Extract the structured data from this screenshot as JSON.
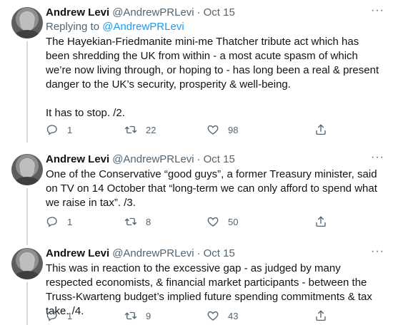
{
  "tweets": [
    {
      "name": "Andrew Levi",
      "handle": "@AndrewPRLevi",
      "separator": "·",
      "date": "Oct 15",
      "more": "···",
      "replying_prefix": "Replying to ",
      "replying_to": "@AndrewPRLevi",
      "text": "The Hayekian-Friedmanite mini-me Thatcher tribute act which has been shredding the UK from within - a most acute spasm of which we’re now living through, or hoping to - has long been a real & present danger to the UK’s security, prosperity & well-being.\n\nIt has to stop. /2.",
      "replies": "1",
      "retweets": "22",
      "likes": "98"
    },
    {
      "name": "Andrew Levi",
      "handle": "@AndrewPRLevi",
      "separator": "·",
      "date": "Oct 15",
      "more": "···",
      "text": "One of the Conservative “good guys”, a former Treasury minister, said on TV on 14 October that “long-term we can only afford to spend what we raise in tax”. /3.",
      "replies": "1",
      "retweets": "8",
      "likes": "50"
    },
    {
      "name": "Andrew Levi",
      "handle": "@AndrewPRLevi",
      "separator": "·",
      "date": "Oct 15",
      "more": "···",
      "text": "This was in reaction to the excessive gap - as judged by many respected economists, & financial market participants - between the Truss-Kwarteng budget’s implied future spending commitments & tax take. /4.",
      "replies": "1",
      "retweets": "9",
      "likes": "43"
    }
  ],
  "icons": {
    "reply": "reply-icon",
    "retweet": "retweet-icon",
    "like": "heart-icon",
    "share": "share-icon",
    "more": "more-icon"
  }
}
